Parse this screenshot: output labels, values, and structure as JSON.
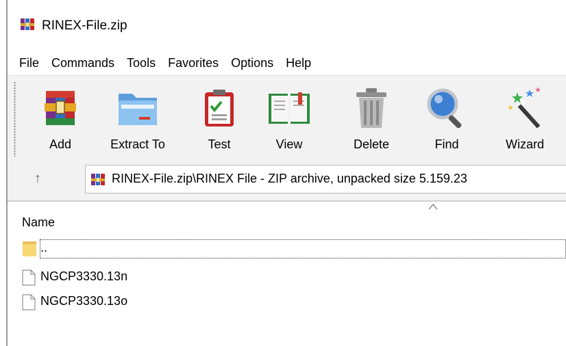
{
  "window": {
    "title": "RINEX-File.zip"
  },
  "menu": [
    "File",
    "Commands",
    "Tools",
    "Favorites",
    "Options",
    "Help"
  ],
  "toolbar": {
    "buttons": [
      {
        "label": "Add",
        "icon": "add-archive-icon"
      },
      {
        "label": "Extract To",
        "icon": "extract-folder-icon"
      },
      {
        "label": "Test",
        "icon": "test-clipboard-icon"
      },
      {
        "label": "View",
        "icon": "view-book-icon"
      },
      {
        "label": "Delete",
        "icon": "trash-can-icon"
      },
      {
        "label": "Find",
        "icon": "magnifier-icon"
      },
      {
        "label": "Wizard",
        "icon": "magic-wand-icon"
      }
    ]
  },
  "address": {
    "up_icon": "up-arrow-icon",
    "path": "RINEX-File.zip\\RINEX File - ZIP archive, unpacked size 5.159.23"
  },
  "filelist": {
    "columns": [
      "Name"
    ],
    "rows": [
      {
        "name": "..",
        "icon": "folder-icon",
        "selected": true
      },
      {
        "name": "NGCP3330.13n",
        "icon": "file-icon",
        "selected": false
      },
      {
        "name": "NGCP3330.13o",
        "icon": "file-icon",
        "selected": false
      }
    ]
  },
  "colors": {
    "toolbar_bg": "#f2f2f2",
    "folder_yellow": "#f8d775",
    "winrar_red": "#c0282c"
  }
}
